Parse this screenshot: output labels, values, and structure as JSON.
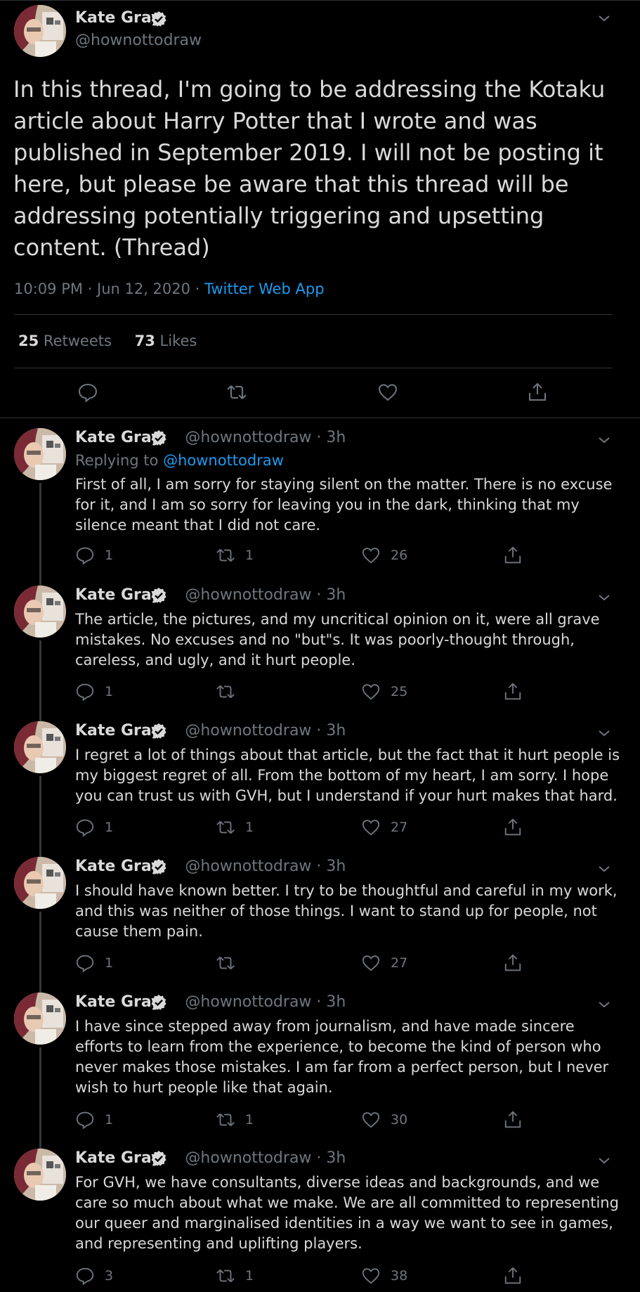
{
  "author": {
    "name": "Kate Gray",
    "handle": "@hownottodraw"
  },
  "main_tweet": {
    "text": "In this thread, I'm going to be addressing the Kotaku article about Harry Potter that I wrote and was published in September 2019. I will not be posting it here, but please be aware that this thread will be addressing potentially triggering and upsetting content. (Thread)",
    "time": "10:09 PM · Jun 12, 2020 · ",
    "app": "Twitter Web App",
    "retweets_count": "25",
    "retweets_label": "Retweets",
    "likes_count": "73",
    "likes_label": "Likes"
  },
  "replies": [
    {
      "name": "Kate Gray",
      "handle_time": "@hownottodraw · 3h",
      "replying_label": "Replying to ",
      "replying_to": "@hownottodraw",
      "text": "First of all, I am sorry for staying silent on the matter. There is no excuse for it, and I am so sorry for leaving you in the dark, thinking that my silence meant that I did not care.",
      "replies": "1",
      "retweets": "1",
      "likes": "26"
    },
    {
      "name": "Kate Gray",
      "handle_time": "@hownottodraw · 3h",
      "text": "The article, the pictures, and my uncritical opinion on it, were all grave mistakes. No excuses and no \"but\"s. It was poorly-thought through, careless, and ugly, and it hurt people.",
      "replies": "1",
      "retweets": "",
      "likes": "25"
    },
    {
      "name": "Kate Gray",
      "handle_time": "@hownottodraw · 3h",
      "text": "I regret a lot of things about that article, but the fact that it hurt people is my biggest regret of all. From the bottom of my heart, I am sorry. I hope you can trust us with GVH, but I understand if your hurt makes that hard.",
      "replies": "1",
      "retweets": "1",
      "likes": "27"
    },
    {
      "name": "Kate Gray",
      "handle_time": "@hownottodraw · 3h",
      "text": "I should have known better. I try to be thoughtful and careful in my work, and this was neither of those things. I want to stand up for people, not cause them pain.",
      "replies": "1",
      "retweets": "",
      "likes": "27"
    },
    {
      "name": "Kate Gray",
      "handle_time": "@hownottodraw · 3h",
      "text": "I have since stepped away from journalism, and have made sincere efforts to learn from the experience, to become the kind of person who never makes those mistakes. I am far from a perfect person, but I never wish to hurt people like that again.",
      "replies": "1",
      "retweets": "1",
      "likes": "30"
    },
    {
      "name": "Kate Gray",
      "handle_time": "@hownottodraw · 3h",
      "text": "For GVH, we have consultants, diverse ideas and backgrounds, and we care so much about what we make. We are all committed to representing our queer and marginalised identities in a way we want to see in games, and representing and uplifting players.",
      "replies": "3",
      "retweets": "1",
      "likes": "38"
    }
  ],
  "colors": {
    "background": "#000000",
    "text": "#d9d9d9",
    "muted": "#6e767d",
    "link": "#1d9bf0",
    "divider": "#2f3336"
  },
  "icons": [
    "verified-badge-icon",
    "chevron-down-icon",
    "reply-icon",
    "retweet-icon",
    "like-icon",
    "share-icon"
  ]
}
